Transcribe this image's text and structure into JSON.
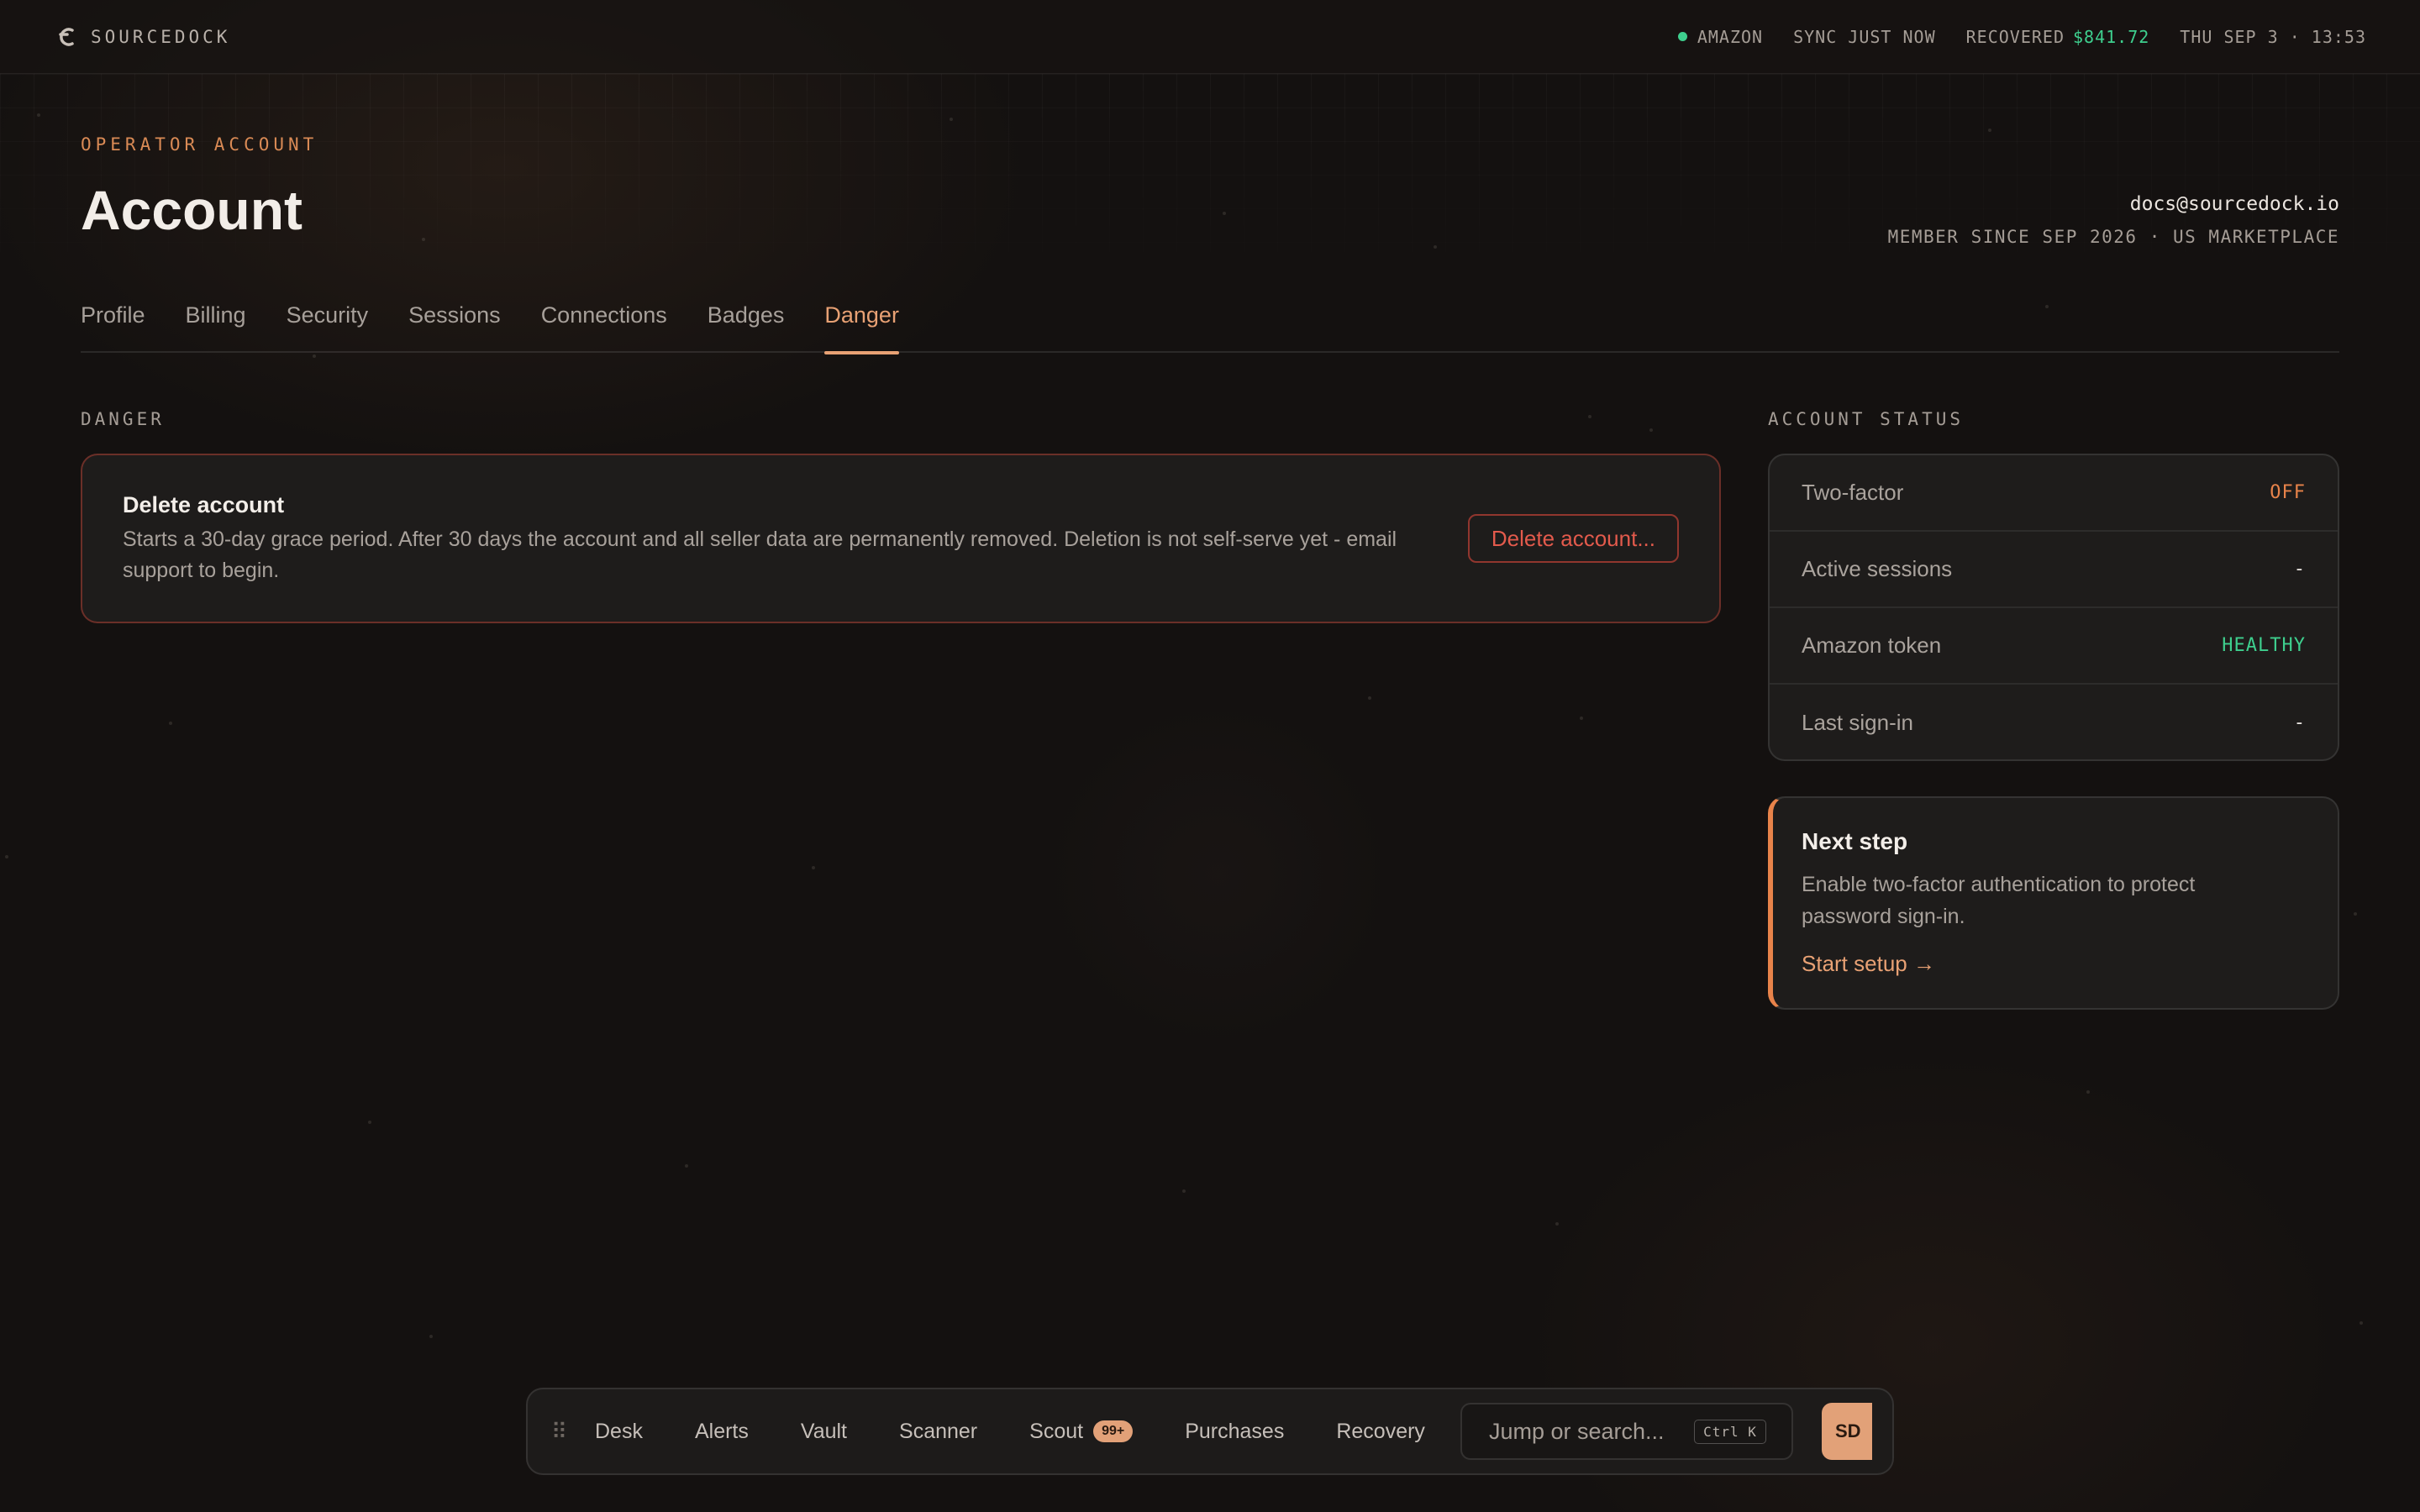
{
  "brand": {
    "name": "SOURCEDOCK"
  },
  "topbar": {
    "marketplace": "AMAZON",
    "sync": "SYNC JUST NOW",
    "recovered_label": "RECOVERED",
    "recovered_value": "$841.72",
    "datetime": "THU SEP 3 · 13:53"
  },
  "header": {
    "eyebrow": "OPERATOR ACCOUNT",
    "title": "Account",
    "email": "docs@sourcedock.io",
    "meta": "MEMBER SINCE SEP 2026 · US MARKETPLACE"
  },
  "tabs": [
    {
      "label": "Profile",
      "active": false
    },
    {
      "label": "Billing",
      "active": false
    },
    {
      "label": "Security",
      "active": false
    },
    {
      "label": "Sessions",
      "active": false
    },
    {
      "label": "Connections",
      "active": false
    },
    {
      "label": "Badges",
      "active": false
    },
    {
      "label": "Danger",
      "active": true
    }
  ],
  "danger": {
    "section_label": "DANGER",
    "title": "Delete account",
    "description": "Starts a 30-day grace period. After 30 days the account and all seller data are permanently removed. Deletion is not self-serve yet - email support to begin.",
    "button": "Delete account..."
  },
  "account_status": {
    "section_label": "ACCOUNT STATUS",
    "rows": [
      {
        "label": "Two-factor",
        "value": "OFF"
      },
      {
        "label": "Active sessions",
        "value": "-"
      },
      {
        "label": "Amazon token",
        "value": "HEALTHY"
      },
      {
        "label": "Last sign-in",
        "value": "-"
      }
    ]
  },
  "next_step": {
    "title": "Next step",
    "description": "Enable two-factor authentication to protect password sign-in.",
    "link": "Start setup →"
  },
  "dock": {
    "items": [
      "Desk",
      "Alerts",
      "Vault",
      "Scanner",
      "Scout",
      "Purchases",
      "Recovery"
    ],
    "scout_badge": "99+",
    "search_placeholder": "Jump or search...",
    "shortcut": "Ctrl K",
    "avatar": "SD"
  },
  "colors": {
    "accent": "#e8a174",
    "danger": "#e35a4c",
    "success": "#3ecf8e",
    "warning": "#e8834a",
    "background": "#141110"
  }
}
